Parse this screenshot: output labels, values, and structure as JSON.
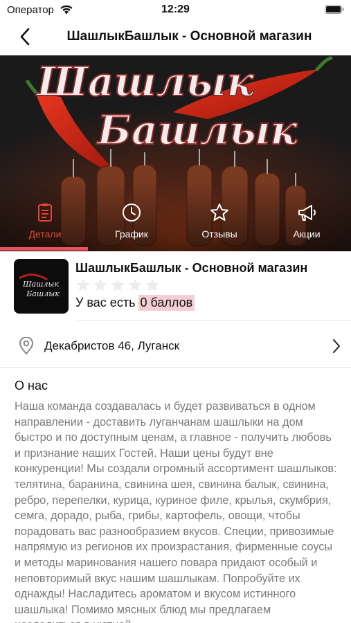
{
  "status_bar": {
    "carrier": "Оператор",
    "time": "12:29"
  },
  "nav": {
    "title": "ШашлыкБашлык - Основной магазин"
  },
  "banner": {
    "logo_line1": "Шашлык",
    "logo_line2": "Башлык"
  },
  "tabs": [
    {
      "label": "Детали",
      "icon": "clipboard-icon",
      "active": true
    },
    {
      "label": "График",
      "icon": "clock-icon",
      "active": false
    },
    {
      "label": "Отзывы",
      "icon": "star-icon",
      "active": false
    },
    {
      "label": "Акции",
      "icon": "megaphone-icon",
      "active": false
    }
  ],
  "store": {
    "name": "ШашлыкБашлык - Основной магазин",
    "logo_line1": "Шашлык",
    "logo_line2": "Башлык",
    "rating": 0,
    "rating_max": 5,
    "points_prefix": "У вас есть",
    "points_value": "0 баллов"
  },
  "address": {
    "text": "Декабристов 46, Луганск"
  },
  "about": {
    "title": "О нас",
    "text": "Наша команда создавалась и будет развиваться в одном направлении - доставить луганчанам шашлыки на дом быстро и по доступным ценам, а главное - получить любовь и признание наших Гостей. Наши цены будут вне конкуренции! Мы создали огромный ассортимент шашлыков: телятина, баранина, свинина шея, свинина балык, свинина, ребро, перепелки, курица, куриное филе, крылья, скумбрия, семга, дорадо, рыба, грибы, картофель, овощи, чтобы порадовать вас разнообразием вкусов. Специи, привозимые напрямую из регионов их произрастания, фирменные соусы и методы маринования нашего повара придают особый и неповторимый вкус нашим шашлыкам. Попробуйте их однажды! Насладитесь ароматом и вкусом истинного шашлыка! Помимо мясных блюд мы предлагаем насладиться в уютной"
  },
  "colors": {
    "accent": "#e8525b",
    "active_tab_text": "#e3453d",
    "points_highlight": "#f4cfd1",
    "body_text": "#7a7a7a"
  }
}
